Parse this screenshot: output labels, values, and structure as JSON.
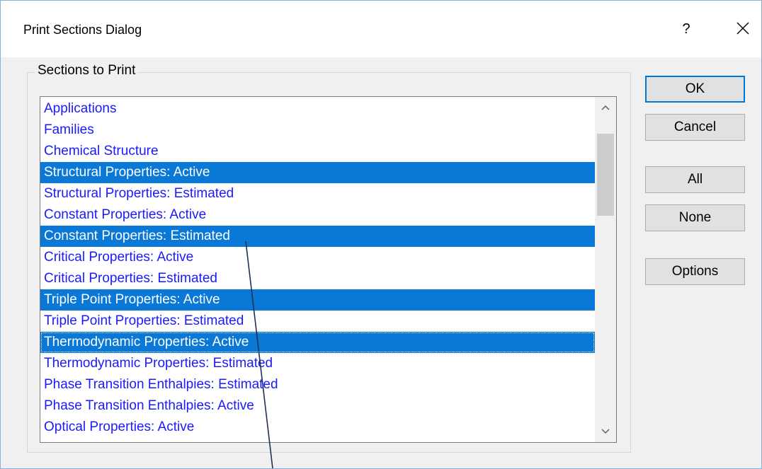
{
  "window": {
    "title": "Print Sections Dialog",
    "help_label": "?"
  },
  "group": {
    "legend": "Sections to Print"
  },
  "list": {
    "items": [
      {
        "label": "Applications",
        "selected": false
      },
      {
        "label": "Families",
        "selected": false
      },
      {
        "label": "Chemical Structure",
        "selected": false
      },
      {
        "label": "Structural Properties: Active",
        "selected": true
      },
      {
        "label": "Structural Properties: Estimated",
        "selected": false
      },
      {
        "label": "Constant Properties: Active",
        "selected": false
      },
      {
        "label": "Constant Properties: Estimated",
        "selected": true
      },
      {
        "label": "Critical Properties: Active",
        "selected": false
      },
      {
        "label": "Critical Properties: Estimated",
        "selected": false
      },
      {
        "label": "Triple Point Properties: Active",
        "selected": true
      },
      {
        "label": "Triple Point Properties: Estimated",
        "selected": false
      },
      {
        "label": "Thermodynamic Properties: Active",
        "selected": true
      },
      {
        "label": "Thermodynamic Properties: Estimated",
        "selected": false
      },
      {
        "label": "Phase Transition Enthalpies: Estimated",
        "selected": false
      },
      {
        "label": "Phase Transition Enthalpies: Active",
        "selected": false
      },
      {
        "label": "Optical Properties: Active",
        "selected": false
      }
    ]
  },
  "buttons": {
    "ok": "OK",
    "cancel": "Cancel",
    "all": "All",
    "none": "None",
    "options": "Options"
  },
  "colors": {
    "item_text": "#1a1aff",
    "selection": "#0a78d7",
    "default_button_border": "#0078d7"
  }
}
